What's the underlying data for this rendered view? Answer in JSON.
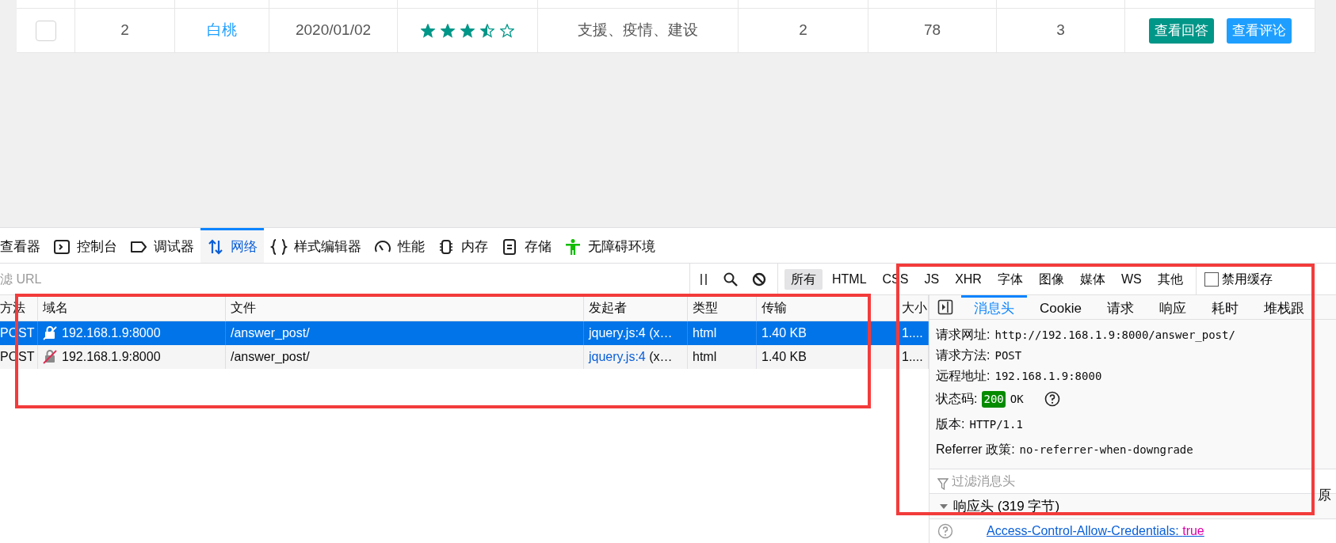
{
  "table_row": {
    "checked": false,
    "number": "2",
    "name": "白桃",
    "date": "2020/01/02",
    "stars": 3.5,
    "tags": "支援、疫情、建设",
    "column_6": "2",
    "column_7": "78",
    "column_8": "3",
    "actions": [
      {
        "label": "查看回答",
        "kind": "answer"
      },
      {
        "label": "查看评论",
        "kind": "comment"
      }
    ]
  },
  "devtools": {
    "tabs": [
      {
        "label": "查看器",
        "selected": false
      },
      {
        "label": "控制台",
        "selected": false
      },
      {
        "label": "调试器",
        "selected": false
      },
      {
        "label": "网络",
        "selected": true
      },
      {
        "label": "样式编辑器",
        "selected": false
      },
      {
        "label": "性能",
        "selected": false
      },
      {
        "label": "内存",
        "selected": false
      },
      {
        "label": "存储",
        "selected": false
      },
      {
        "label": "无障碍环境",
        "selected": false
      }
    ],
    "url_filter": {
      "placeholder": "滤 URL"
    },
    "type_filters": [
      {
        "label": "所有",
        "selected": true
      },
      {
        "label": "HTML",
        "selected": false
      },
      {
        "label": "CSS",
        "selected": false
      },
      {
        "label": "JS",
        "selected": false
      },
      {
        "label": "XHR",
        "selected": false
      },
      {
        "label": "字体",
        "selected": false
      },
      {
        "label": "图像",
        "selected": false
      },
      {
        "label": "媒体",
        "selected": false
      },
      {
        "label": "WS",
        "selected": false
      },
      {
        "label": "其他",
        "selected": false
      }
    ],
    "disable_cache": {
      "label": "禁用缓存",
      "checked": false
    },
    "columns": [
      "方法",
      "域名",
      "文件",
      "发起者",
      "类型",
      "传输",
      "大小"
    ],
    "requests": [
      {
        "selected": true,
        "method": "POST",
        "domain": "192.168.1.9:8000",
        "file": "/answer_post/",
        "initiator_link": "jquery.js:4",
        "initiator_rest": " (x…",
        "type": "html",
        "transferred": "1.40 KB",
        "size": "1...."
      },
      {
        "selected": false,
        "method": "POST",
        "domain": "192.168.1.9:8000",
        "file": "/answer_post/",
        "initiator_link": "jquery.js:4",
        "initiator_rest": " (x…",
        "type": "html",
        "transferred": "1.40 KB",
        "size": "1...."
      }
    ],
    "panel": {
      "tabs": [
        {
          "label": "消息头",
          "selected": true
        },
        {
          "label": "Cookie",
          "selected": false
        },
        {
          "label": "请求",
          "selected": false
        },
        {
          "label": "响应",
          "selected": false
        },
        {
          "label": "耗时",
          "selected": false
        },
        {
          "label": "堆栈跟",
          "selected": false
        }
      ],
      "summary": [
        {
          "kind": "plain",
          "label": "请求网址:",
          "value": "http://192.168.1.9:8000/answer_post/"
        },
        {
          "kind": "plain",
          "label": "请求方法:",
          "value": "POST"
        },
        {
          "kind": "plain",
          "label": "远程地址:",
          "value": "192.168.1.9:8000"
        },
        {
          "kind": "status",
          "label": "状态码:",
          "code": "200",
          "value": "OK"
        },
        {
          "kind": "plain",
          "label": "版本:",
          "value": "HTTP/1.1"
        },
        {
          "kind": "plain",
          "label": "Referrer 政策:",
          "value": "no-referrer-when-downgrade"
        }
      ],
      "header_filter": {
        "placeholder": "过滤消息头"
      },
      "section": {
        "label": "响应头 (319 字节)",
        "expanded": true
      },
      "header_row": {
        "name": "Access-Control-Allow-Credentials:",
        "value": "true"
      },
      "side_text": "原"
    }
  }
}
